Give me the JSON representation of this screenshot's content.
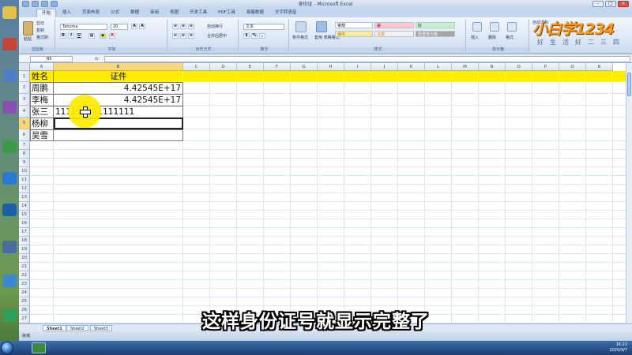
{
  "window": {
    "title": "身份证 - Microsoft Excel"
  },
  "ribbon": {
    "tabs": [
      "开始",
      "插入",
      "页面布局",
      "公式",
      "数据",
      "审阅",
      "视图",
      "开发工具",
      "PDF工具",
      "易春数据",
      "文字转语音"
    ],
    "clipboard": {
      "paste": "粘贴",
      "cut": "剪切",
      "copy": "复制",
      "format_painter": "格式刷",
      "group": "剪贴板"
    },
    "font": {
      "name": "Tahoma",
      "size": "20",
      "group": "字体"
    },
    "alignment": {
      "wrap": "自动换行",
      "merge": "合并后居中",
      "group": "对齐方式"
    },
    "number": {
      "format": "文本",
      "group": "数字"
    },
    "styles": {
      "conditional": "条件格式",
      "table": "套用\n表格格式",
      "normal": "常规",
      "bad": "差",
      "good": "好",
      "neutral": "适中",
      "calc": "计算",
      "check": "检查单元格",
      "group": "样式"
    },
    "cells": {
      "insert": "插入",
      "delete": "删除",
      "format": "格式",
      "group": "单元格"
    },
    "editing": {
      "autosum": "自动求和"
    }
  },
  "formula_bar": {
    "name_box": "B5",
    "fx": "fx"
  },
  "columns": [
    "A",
    "B",
    "C",
    "D",
    "E",
    "F",
    "G",
    "H",
    "I",
    "J",
    "K",
    "L",
    "M",
    "N",
    "O",
    "P",
    "Q",
    "R"
  ],
  "rows": [
    "1",
    "2",
    "3",
    "4",
    "5",
    "6",
    "7",
    "8",
    "9",
    "10",
    "11",
    "12",
    "13",
    "14",
    "15",
    "16",
    "17",
    "18",
    "19",
    "20",
    "21",
    "22",
    "23",
    "24",
    "25",
    "26",
    "27"
  ],
  "cells": {
    "a1": "姓名",
    "b1": "证件",
    "a2": "周鹏",
    "b2": "4.42545E+17",
    "a3": "李梅",
    "b3": "4.42545E+17",
    "a4": "张三",
    "b4": "111111111111111",
    "a5": "杨柳",
    "a6": "吴雪"
  },
  "sheets": [
    "Sheet1",
    "Sheet2",
    "Sheet3"
  ],
  "status": {
    "mode": "就绪"
  },
  "caption": "这样身份证号就显示完整了",
  "logo": {
    "main": "小白学1234",
    "sub": "好生活好二三四"
  },
  "taskbar": {
    "time": "16:23",
    "date": "2020/9/7"
  },
  "colors": {
    "header_fill": "#ffed00",
    "cursor_ring": "#ffec00",
    "caption": "#ffffff"
  }
}
